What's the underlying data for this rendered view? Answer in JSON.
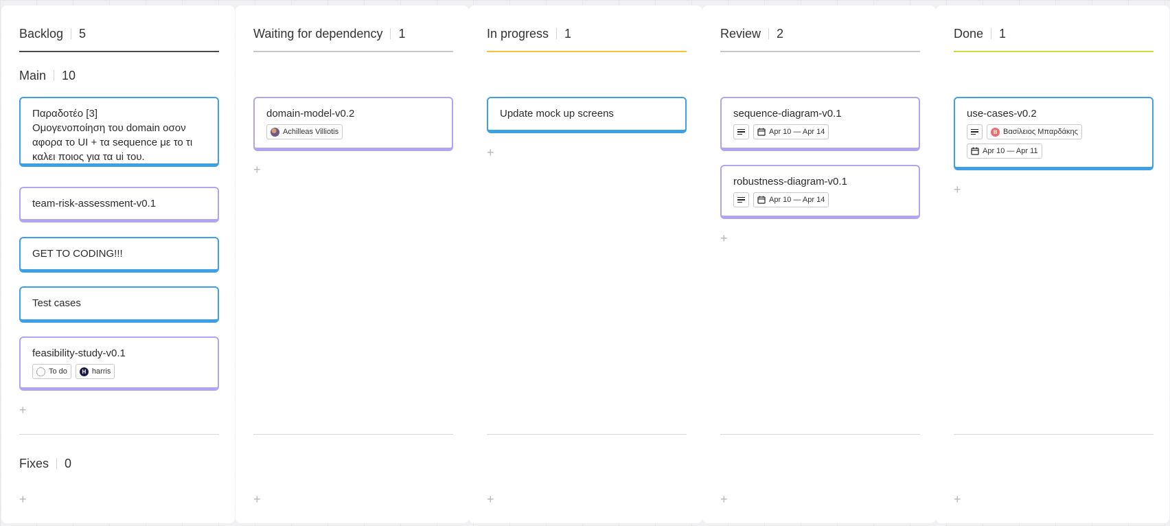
{
  "columns": [
    {
      "title": "Backlog",
      "count": "5"
    },
    {
      "title": "Waiting for dependency",
      "count": "1"
    },
    {
      "title": "In progress",
      "count": "1"
    },
    {
      "title": "Review",
      "count": "2"
    },
    {
      "title": "Done",
      "count": "1"
    }
  ],
  "lanes": {
    "main": {
      "title": "Main",
      "count": "10"
    },
    "fixes": {
      "title": "Fixes",
      "count": "0"
    }
  },
  "add_symbol": "+",
  "cards": {
    "backlog": [
      {
        "title": "Παραδοτέο [3]\nΟμογενοποίηση του domain οσον αφορα το UI + τα sequence με το τι καλει ποιος για τα ui του."
      },
      {
        "title": "team-risk-assessment-v0.1"
      },
      {
        "title": "GET TO CODING!!!"
      },
      {
        "title": "Test cases"
      },
      {
        "title": "feasibility-study-v0.1",
        "status": "To do",
        "assignee": "harris",
        "assignee_initial": "H"
      }
    ],
    "waiting": [
      {
        "title": "domain-model-v0.2",
        "assignee": "Achilleas Villiotis"
      }
    ],
    "in_progress": [
      {
        "title": "Update mock up screens"
      }
    ],
    "review": [
      {
        "title": "sequence-diagram-v0.1",
        "dates": "Apr 10 — Apr 14"
      },
      {
        "title": "robustness-diagram-v0.1",
        "dates": "Apr 10 — Apr 14"
      }
    ],
    "done": [
      {
        "title": "use-cases-v0.2",
        "assignee": "Βασίλειος Μπαρδάκης",
        "assignee_initial": "B",
        "dates": "Apr 10 — Apr 11"
      }
    ]
  },
  "colors": {
    "blue_card": "#3d9fe4",
    "purple_card": "#b3a4f3",
    "in_progress_accent": "#f6c23a",
    "done_accent": "#cddc39"
  }
}
